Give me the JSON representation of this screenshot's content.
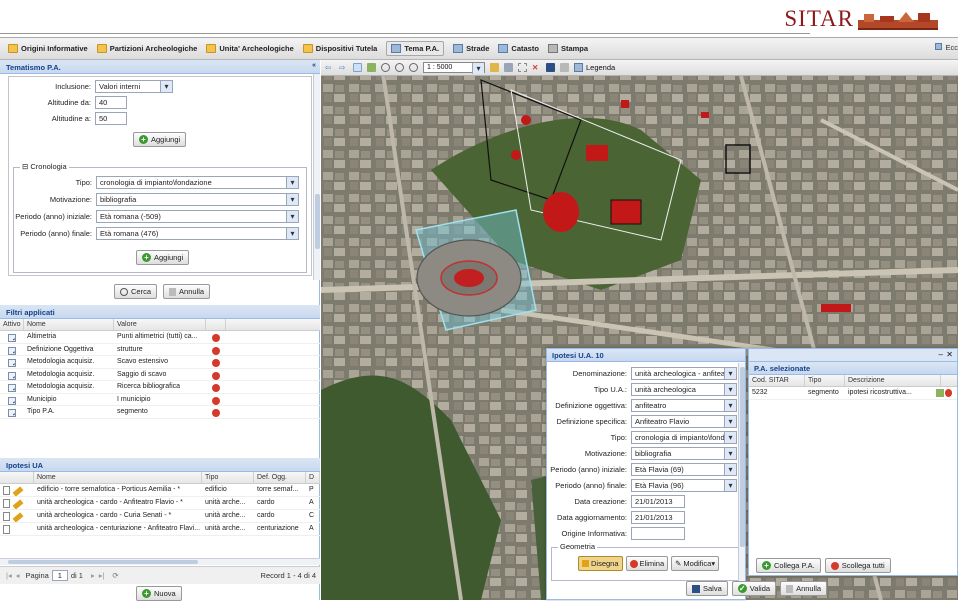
{
  "header": {
    "logo_text": "SITAR"
  },
  "nav": {
    "items": [
      {
        "label": "Origini Informative",
        "icon": "folder-icon"
      },
      {
        "label": "Partizioni Archeologiche",
        "icon": "folder-icon"
      },
      {
        "label": "Unita' Archeologiche",
        "icon": "folder-icon"
      },
      {
        "label": "Dispositivi Tutela",
        "icon": "folder-icon"
      },
      {
        "label": "Tema P.A.",
        "icon": "grid-icon"
      },
      {
        "label": "Strade",
        "icon": "grid-icon"
      },
      {
        "label": "Catasto",
        "icon": "grid-icon"
      },
      {
        "label": "Stampa",
        "icon": "printer-icon"
      }
    ],
    "right_label": "Ecc"
  },
  "tematismo": {
    "title": "Tematismo P.A.",
    "inclusione_label": "Inclusione:",
    "inclusione_value": "Valori interni",
    "altitudine_da_label": "Altitudine da:",
    "altitudine_da_value": "40",
    "altitudine_a_label": "Altitudine a:",
    "altitudine_a_value": "50",
    "aggiungi_label": "Aggiungi",
    "cronologia_legend": "Cronologia",
    "tipo_label": "Tipo:",
    "tipo_value": "cronologia di impianto\\fondazione",
    "motivazione_label": "Motivazione:",
    "motivazione_value": "bibliografia",
    "periodo_iniziale_label": "Periodo (anno) iniziale:",
    "periodo_iniziale_value": "Età romana (-509)",
    "periodo_finale_label": "Periodo (anno) finale:",
    "periodo_finale_value": "Età romana (476)",
    "aggiungi2_label": "Aggiungi",
    "cerca_label": "Cerca",
    "annulla_label": "Annulla"
  },
  "filtri": {
    "title": "Filtri applicati",
    "columns": [
      "Attivo",
      "Nome",
      "Valore"
    ],
    "rows": [
      {
        "nome": "Altimetria",
        "valore": "Punti altimetrici (tutti) ca..."
      },
      {
        "nome": "Definizione Oggettiva",
        "valore": "strutture"
      },
      {
        "nome": "Metodologia acquisiz.",
        "valore": "Scavo estensivo"
      },
      {
        "nome": "Metodologia acquisiz.",
        "valore": "Saggio di scavo"
      },
      {
        "nome": "Metodologia acquisiz.",
        "valore": "Ricerca bibliografica"
      },
      {
        "nome": "Municipio",
        "valore": "I municipio"
      },
      {
        "nome": "Tipo P.A.",
        "valore": "segmento"
      }
    ]
  },
  "ipotesi_list": {
    "title": "Ipotesi UA",
    "columns": [
      "Nome",
      "Tipo",
      "Def. Ogg.",
      "D"
    ],
    "rows": [
      {
        "nome": "edificio - torre semafotica - Porticus Aemilia - *",
        "tipo": "edificio",
        "def": "torre semaf...",
        "d": "P"
      },
      {
        "nome": "unità archeologica - cardo - Anfiteatro Flavio - *",
        "tipo": "unità arche...",
        "def": "cardo",
        "d": "A"
      },
      {
        "nome": "unità archeologica - cardo - Curia Senati - *",
        "tipo": "unità arche...",
        "def": "cardo",
        "d": "C"
      },
      {
        "nome": "unità archeologica - centuriazione - Anfiteatro Flavi...",
        "tipo": "unità arche...",
        "def": "centuriazione",
        "d": "A"
      }
    ],
    "pager_label": "Pagina",
    "pager_value": "1",
    "pager_of": "di 1",
    "records": "Record 1 - 4 di 4",
    "nuova_label": "Nuova"
  },
  "map_toolbar": {
    "scale_value": "1 : 5000",
    "legenda_label": "Legenda"
  },
  "ipotesi_window": {
    "title": "Ipotesi U.A. 10",
    "fields": [
      {
        "label": "Denominazione:",
        "value": "unità archeologica - anfiteatro -"
      },
      {
        "label": "Tipo U.A.:",
        "value": "unità archeologica"
      },
      {
        "label": "Definizione oggettiva:",
        "value": "anfiteatro"
      },
      {
        "label": "Definizione specifica:",
        "value": "Anfiteatro Flavio"
      },
      {
        "label": "Tipo:",
        "value": "cronologia di impianto\\fonda"
      },
      {
        "label": "Motivazione:",
        "value": "bibliografia"
      },
      {
        "label": "Periodo (anno) iniziale:",
        "value": "Età Flavia (69)"
      },
      {
        "label": "Periodo (anno) finale:",
        "value": "Età Flavia (96)"
      },
      {
        "label": "Data creazione:",
        "value": "21/01/2013"
      },
      {
        "label": "Data aggiornamento:",
        "value": "21/01/2013"
      },
      {
        "label": "Origine Informativa:",
        "value": ""
      }
    ],
    "geometria_legend": "Geometria",
    "disegna_label": "Disegna",
    "elimina_label": "Elimina",
    "modifica_label": "Modifica",
    "salva_label": "Salva",
    "valida_label": "Valida",
    "annulla_label": "Annulla"
  },
  "pa_selezionate": {
    "title": "P.A. selezionate",
    "columns": [
      "Cod. SITAR",
      "Tipo",
      "Descrizione"
    ],
    "rows": [
      {
        "cod": "5232",
        "tipo": "segmento",
        "descr": "ipotesi ricostruttiva..."
      }
    ],
    "collega_label": "Collega P.A.",
    "scollega_label": "Scollega tutti"
  },
  "colors": {
    "accent": "#15428b",
    "panel_header": "#c8d8ee",
    "delete": "#d33a2a",
    "add": "#3a9a2f",
    "brand": "#8b1a1a"
  }
}
